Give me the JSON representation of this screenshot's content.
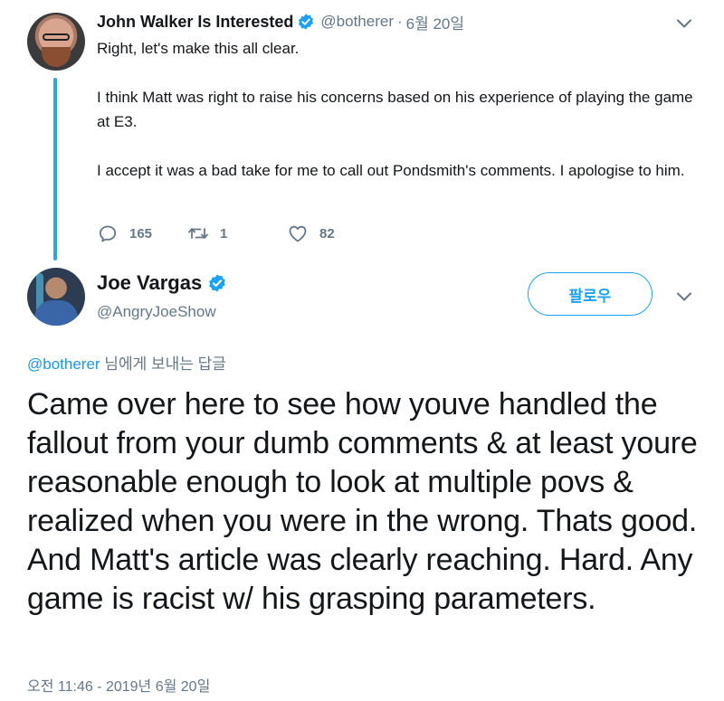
{
  "parent_tweet": {
    "author_name": "John Walker Is Interested",
    "handle": "@botherer",
    "separator": "·",
    "date": "6월 20일",
    "paragraphs": [
      "Right, let's make this all clear.",
      "I think Matt was right to raise his concerns based on his experience of playing the game at E3.",
      "I accept it was a bad take for me to call out Pondsmith's comments. I apologise to him."
    ],
    "actions": {
      "replies": "165",
      "retweets": "1",
      "likes": "82"
    }
  },
  "main_tweet": {
    "author_name": "Joe Vargas",
    "handle": "@AngryJoeShow",
    "follow_label": "팔로우",
    "reply_to_mention": "@botherer",
    "reply_to_suffix": " 님에게 보내는 답글",
    "text": "Came over here to see how youve handled the fallout from your dumb comments & at least youre reasonable enough to look at multiple povs & realized when you were in the wrong. Thats good. And Matt's article was clearly reaching. Hard. Any game is racist w/ his grasping parameters.",
    "timestamp": "오전 11:46 - 2019년 6월 20일"
  },
  "icons": {
    "verified": "verified-badge-icon",
    "reply": "reply-icon",
    "retweet": "retweet-icon",
    "like": "heart-icon",
    "menu": "chevron-down-icon"
  },
  "colors": {
    "accent": "#1da1f2",
    "thread_line": "#2aa9e0",
    "secondary_text": "#657786",
    "text": "#14171a"
  }
}
